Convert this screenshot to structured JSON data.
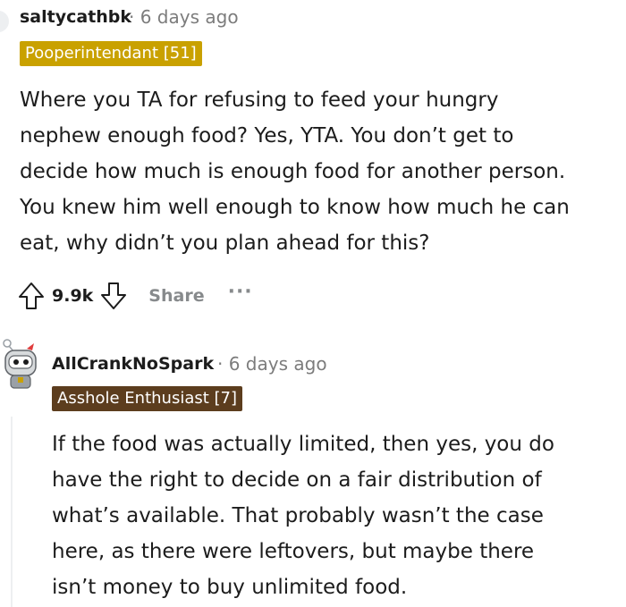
{
  "comment1": {
    "username": "saltycathbk",
    "time": "· 6 days ago",
    "flair": "Pooperintendant [51]",
    "flair_color": "#c9a100",
    "lines": [
      "Where you TA for refusing to feed your hungry",
      "nephew enough food? Yes, YTA. You don’t get to",
      "decide how much is enough food for another person.",
      "You knew him well enough to know how much he can",
      "eat, why didn’t you plan ahead for this?"
    ],
    "score": "9.9k",
    "share_label": "Share",
    "more_label": "···"
  },
  "comment2": {
    "username": "AllCrankNoSpark",
    "time": "· 6 days ago",
    "flair": "Asshole Enthusiast [7]",
    "flair_color": "#5c3d1e",
    "lines": [
      "If the food was actually limited, then yes, you do",
      "have the right to decide on a fair distribution of",
      "what’s available. That probably wasn’t the case",
      "here, as there were leftovers, but maybe there",
      "isn’t money to buy unlimited food."
    ]
  },
  "icons": {
    "upvote": "upvote-arrow-icon",
    "downvote": "downvote-arrow-icon",
    "avatar": "robot-avatar-icon"
  }
}
